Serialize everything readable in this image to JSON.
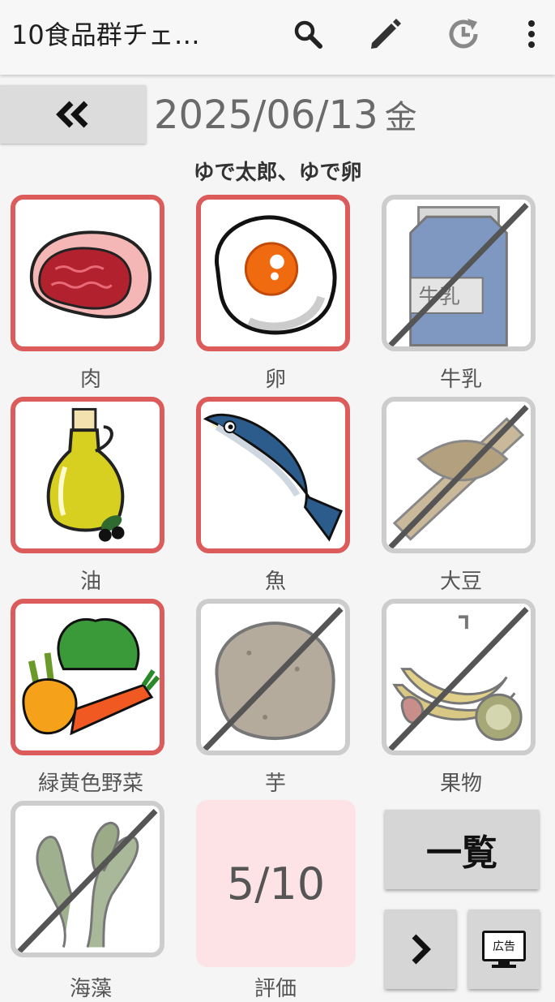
{
  "appbar": {
    "title": "10食品群チェ…",
    "icons": [
      "search-icon",
      "edit-pencil-icon",
      "history-icon",
      "more-vert-icon"
    ]
  },
  "nav": {
    "prev_icon": "double-chevron-left-icon"
  },
  "date": {
    "value": "2025/06/13",
    "weekday": "金"
  },
  "meal": "ゆで太郎、ゆで卵",
  "food_groups": [
    {
      "label": "肉",
      "checked": true,
      "icon": "meat-icon"
    },
    {
      "label": "卵",
      "checked": true,
      "icon": "egg-icon"
    },
    {
      "label": "牛乳",
      "checked": false,
      "icon": "milk-icon"
    },
    {
      "label": "油",
      "checked": true,
      "icon": "oil-bottle-icon"
    },
    {
      "label": "魚",
      "checked": true,
      "icon": "fish-icon"
    },
    {
      "label": "大豆",
      "checked": false,
      "icon": "natto-soybean-icon"
    },
    {
      "label": "緑黄色野菜",
      "checked": true,
      "icon": "vegetables-icon"
    },
    {
      "label": "芋",
      "checked": false,
      "icon": "potato-icon"
    },
    {
      "label": "果物",
      "checked": false,
      "icon": "fruit-icon"
    },
    {
      "label": "海藻",
      "checked": false,
      "icon": "seaweed-icon"
    }
  ],
  "score": {
    "value": "5/10",
    "label": "評価"
  },
  "buttons": {
    "list_label": "一覧",
    "next_icon": "chevron-right-icon",
    "ad_text": "広告"
  },
  "colors": {
    "checked_border": "#dc5c5c",
    "unchecked_border": "#cdcdcd",
    "score_bg": "#fde3e5"
  }
}
